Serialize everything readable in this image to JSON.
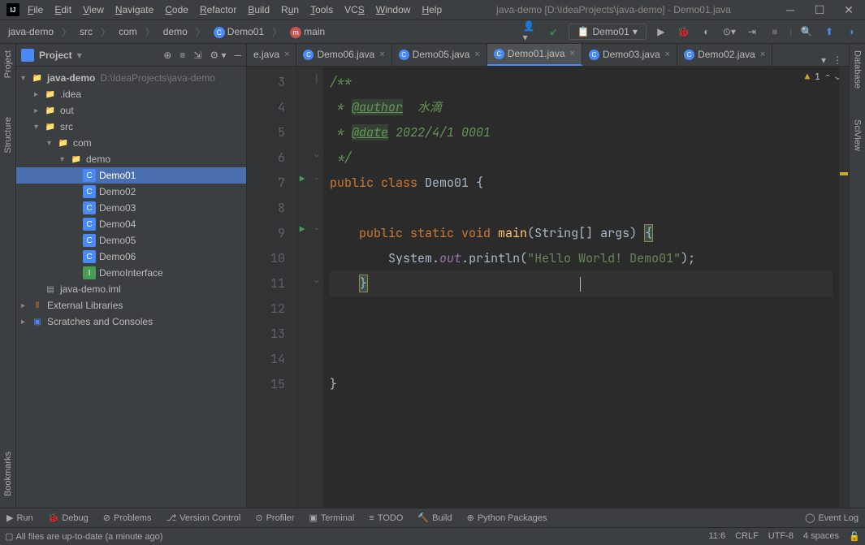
{
  "title": "java-demo [D:\\IdeaProjects\\java-demo] - Demo01.java",
  "menu": [
    "File",
    "Edit",
    "View",
    "Navigate",
    "Code",
    "Refactor",
    "Build",
    "Run",
    "Tools",
    "VCS",
    "Window",
    "Help"
  ],
  "breadcrumb": {
    "root": "java-demo",
    "items": [
      "src",
      "com",
      "demo"
    ],
    "class": "Demo01",
    "method": "main"
  },
  "run_config": "Demo01",
  "sidebar": {
    "title": "Project",
    "root": {
      "name": "java-demo",
      "path": "D:\\IdeaProjects\\java-demo"
    },
    "folders": [
      ".idea",
      "out",
      "src",
      "com",
      "demo"
    ],
    "classes": [
      "Demo01",
      "Demo02",
      "Demo03",
      "Demo04",
      "Demo05",
      "Demo06"
    ],
    "iface": "DemoInterface",
    "iml": "java-demo.iml",
    "ext": "External Libraries",
    "scratches": "Scratches and Consoles"
  },
  "tabs": [
    {
      "label": "e.java",
      "icon": false
    },
    {
      "label": "Demo06.java",
      "icon": true
    },
    {
      "label": "Demo05.java",
      "icon": true
    },
    {
      "label": "Demo01.java",
      "icon": true,
      "active": true
    },
    {
      "label": "Demo03.java",
      "icon": true
    },
    {
      "label": "Demo02.java",
      "icon": true
    }
  ],
  "code": {
    "lines": [
      "3",
      "4",
      "5",
      "6",
      "7",
      "8",
      "9",
      "10",
      "11",
      "12",
      "13",
      "14",
      "15"
    ],
    "author_tag": "@author",
    "author_val": "水滴",
    "date_tag": "@date",
    "date_val": "2022/4/1 0001",
    "class_name": "Demo01",
    "method": "main",
    "args": "String[] args",
    "println": "System",
    "out": "out",
    "call": "println",
    "str": "\"Hello World! Demo01\""
  },
  "warnings": "1",
  "bottom_tools": [
    "Run",
    "Debug",
    "Problems",
    "Version Control",
    "Profiler",
    "Terminal",
    "TODO",
    "Build",
    "Python Packages"
  ],
  "event_log": "Event Log",
  "status_msg": "All files are up-to-date (a minute ago)",
  "status_right": {
    "pos": "11:6",
    "le": "CRLF",
    "enc": "UTF-8",
    "indent": "4 spaces"
  },
  "left_tabs": [
    "Project",
    "Structure",
    "Bookmarks"
  ],
  "right_tabs": [
    "Database",
    "SciView"
  ]
}
